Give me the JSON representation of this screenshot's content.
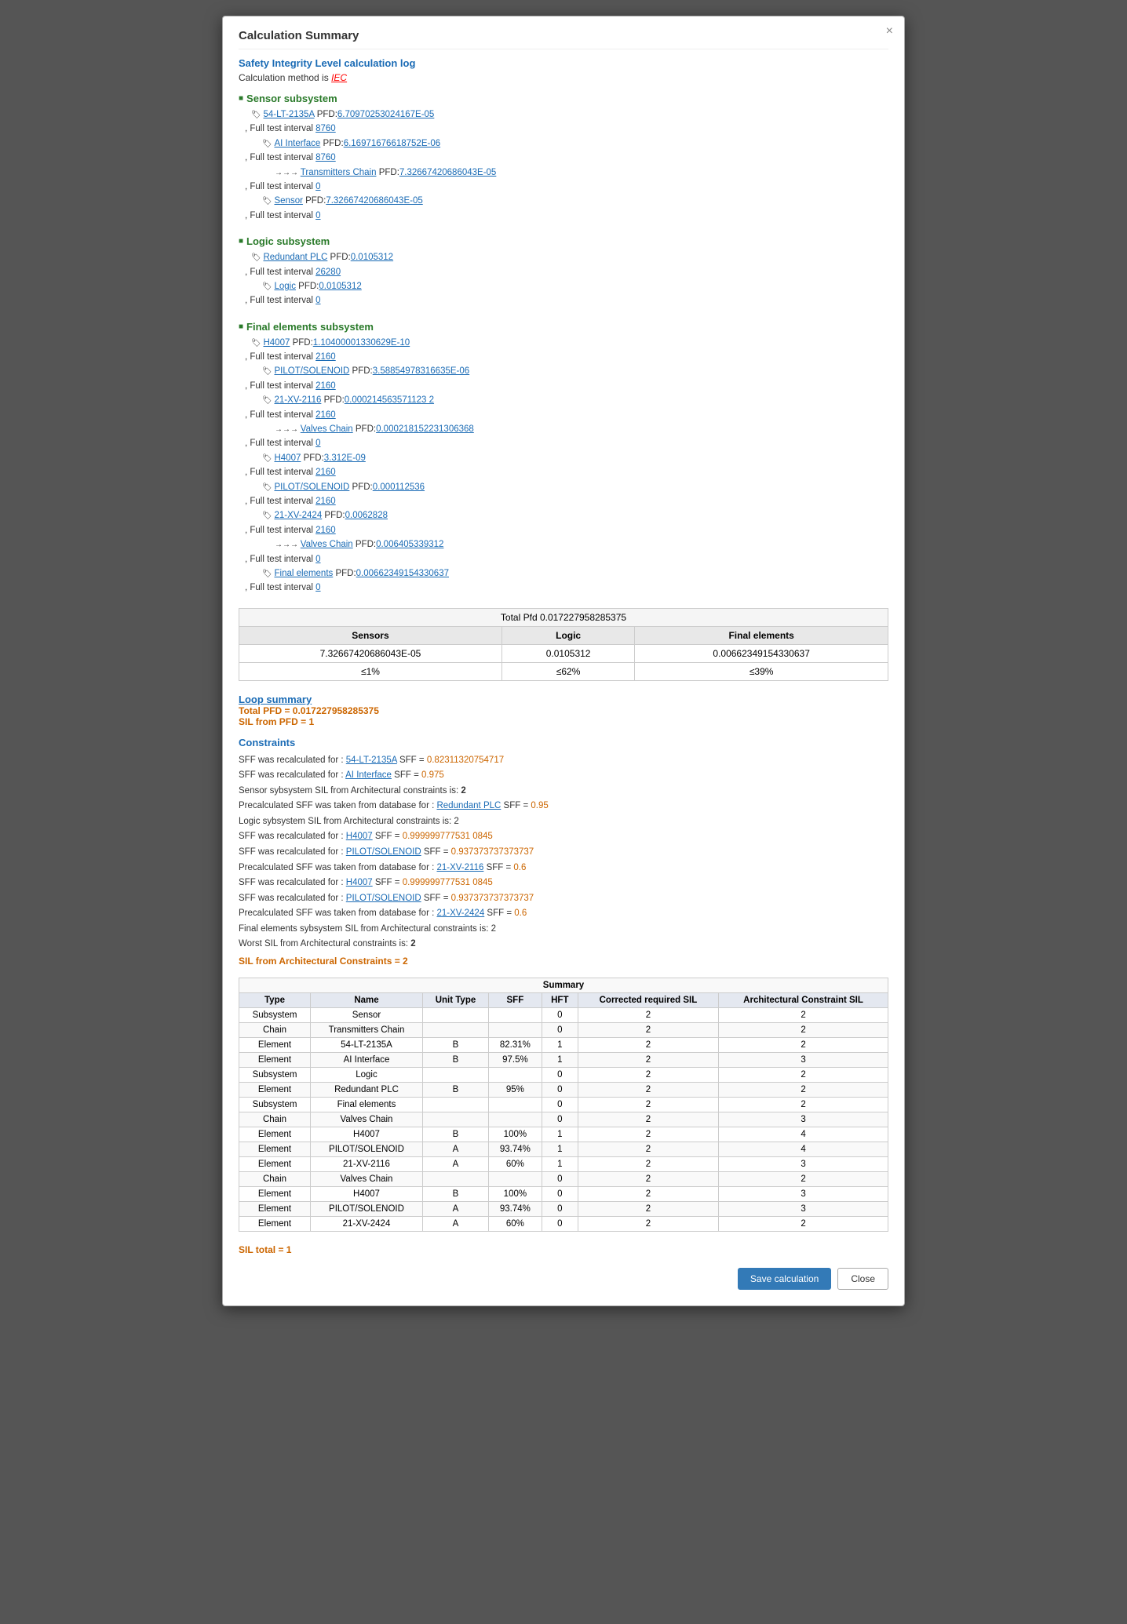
{
  "modal": {
    "title": "Calculation Summary",
    "close_label": "×"
  },
  "header": {
    "sil_title": "Safety Integrity Level calculation log",
    "calc_method_label": "Calculation method is",
    "calc_method_value": "IEC"
  },
  "sensor_subsystem": {
    "title": "Sensor subsystem",
    "lines": [
      {
        "indent": 1,
        "type": "tag",
        "tag": "54-LT-2135A",
        "text": " PFD:",
        "value": "6.70970253024167E-05"
      },
      {
        "indent": 0,
        "text": ", Full test interval ",
        "value": "8760"
      },
      {
        "indent": 2,
        "type": "tag",
        "tag": "AI Interface",
        "text": " PFD:",
        "value": "6.16971676618752E-06"
      },
      {
        "indent": 0,
        "text": ", Full test interval ",
        "value": "8760"
      },
      {
        "indent": 3,
        "type": "arrow",
        "tag": "Transmitters Chain",
        "text": " PFD:",
        "value": "7.32667420686043E-05"
      },
      {
        "indent": 0,
        "text": ", Full test interval ",
        "value": "0"
      },
      {
        "indent": 2,
        "type": "tag",
        "tag": "Sensor",
        "text": " PFD:",
        "value": "7.32667420686043E-05"
      },
      {
        "indent": 0,
        "text": ", Full test interval ",
        "value": "0"
      }
    ]
  },
  "logic_subsystem": {
    "title": "Logic subsystem",
    "lines": [
      {
        "indent": 1,
        "type": "tag",
        "tag": "Redundant PLC",
        "text": " PFD:",
        "value": "0.0105312"
      },
      {
        "indent": 0,
        "text": ", Full test interval ",
        "value": "26280"
      },
      {
        "indent": 2,
        "type": "tag",
        "tag": "Logic",
        "text": " PFD:",
        "value": "0.0105312"
      },
      {
        "indent": 0,
        "text": ", Full test interval ",
        "value": "0"
      }
    ]
  },
  "final_elements_subsystem": {
    "title": "Final elements subsystem",
    "lines": [
      {
        "indent": 1,
        "type": "tag",
        "tag": "H4007",
        "text": " PFD:",
        "value": "1.10400001330629E-10"
      },
      {
        "indent": 0,
        "text": ", Full test interval ",
        "value": "2160"
      },
      {
        "indent": 2,
        "type": "tag",
        "tag": "PILOT/SOLENOID",
        "text": " PFD:",
        "value": "3.58854978316635E-06"
      },
      {
        "indent": 0,
        "text": ", Full test interval ",
        "value": "2160"
      },
      {
        "indent": 2,
        "type": "tag",
        "tag": "21-XV-2116",
        "text": " PFD:",
        "value": "0.000214563571123 2"
      },
      {
        "indent": 0,
        "text": ", Full test interval ",
        "value": "2160"
      },
      {
        "indent": 3,
        "type": "arrow",
        "tag": "Valves Chain",
        "text": " PFD:",
        "value": "0.000218152231306368"
      },
      {
        "indent": 0,
        "text": ", Full test interval ",
        "value": "0"
      },
      {
        "indent": 2,
        "type": "tag",
        "tag": "H4007",
        "text": " PFD:",
        "value": "3.312E-09"
      },
      {
        "indent": 0,
        "text": ", Full test interval ",
        "value": "2160"
      },
      {
        "indent": 2,
        "type": "tag",
        "tag": "PILOT/SOLENOID",
        "text": " PFD:",
        "value": "0.000112536"
      },
      {
        "indent": 0,
        "text": ", Full test interval ",
        "value": "2160"
      },
      {
        "indent": 2,
        "type": "tag",
        "tag": "21-XV-2424",
        "text": " PFD:",
        "value": "0.0062828"
      },
      {
        "indent": 0,
        "text": ", Full test interval ",
        "value": "2160"
      },
      {
        "indent": 3,
        "type": "arrow",
        "tag": "Valves Chain",
        "text": " PFD:",
        "value": "0.006405339312"
      },
      {
        "indent": 0,
        "text": ", Full test interval ",
        "value": "0"
      },
      {
        "indent": 2,
        "type": "tag",
        "tag": "Final elements",
        "text": " PFD:",
        "value": "0.00662349154330637"
      },
      {
        "indent": 0,
        "text": ", Full test interval ",
        "value": "0"
      }
    ]
  },
  "pfd_table": {
    "total_pfd": "Total Pfd 0.017227958285375",
    "headers": [
      "Sensors",
      "Logic",
      "Final elements"
    ],
    "values": [
      "7.32667420686043E-05",
      "0.0105312",
      "0.00662349154330637"
    ],
    "percentages": [
      "≤1%",
      "≤62%",
      "≤39%"
    ]
  },
  "loop_summary": {
    "title": "Loop summary",
    "total_pfd": "Total PFD = 0.017227958285375",
    "sil_from_pfd": "SIL from PFD = 1"
  },
  "constraints": {
    "title": "Constraints",
    "lines": [
      "SFF was recalculated for : 54-LT-2135A  SFF = 0.82311320754717",
      "SFF was recalculated for : AI Interface  SFF = 0.975",
      "Sensor sybsystem SIL from Architectural constraints is:  2",
      "Precalculated SFF was taken from database for :  Redundant PLC  SFF = 0.95",
      "Logic sybsystem SIL from Architectural constraints is: 2",
      "SFF was recalculated for : H4007  SFF = 0.99999977753 10845",
      "SFF was recalculated for : PILOT/SOLENOID  SFF = 0.937373737373737",
      "Precalculated SFF was taken from database for :  21-XV-2116  SFF = 0.6",
      "SFF was recalculated for : H4007  SFF = 0.999999777531 0845",
      "SFF was recalculated for : PILOT/SOLENOID  SFF = 0.937373737373737",
      "Precalculated SFF was taken from database for :  21-XV-2424  SFF = 0.6",
      "Final elements sybsystem SIL from Architectural constraints is: 2",
      "Worst SIL from Architectural constraints is:  2",
      "SIL from Architectural Constraints = 2"
    ],
    "links": {
      "54-LT-2135A": "54-LT-2135A",
      "AI Interface": "AI Interface",
      "Redundant PLC": "Redundant PLC",
      "H4007_1": "H4007",
      "PILOT/SOLENOID_1": "PILOT/SOLENOID",
      "21-XV-2116": "21-XV-2116",
      "H4007_2": "H4007",
      "PILOT/SOLENOID_2": "PILOT/SOLENOID",
      "21-XV-2424": "21-XV-2424"
    }
  },
  "summary_table": {
    "title": "Summary",
    "headers": [
      "Type",
      "Name",
      "Unit Type",
      "SFF",
      "HFT",
      "Corrected required SIL",
      "Architectural Constraint SIL"
    ],
    "rows": [
      [
        "Subsystem",
        "Sensor",
        "",
        "",
        "0",
        "2",
        "2"
      ],
      [
        "Chain",
        "Transmitters Chain",
        "",
        "",
        "0",
        "2",
        "2"
      ],
      [
        "Element",
        "54-LT-2135A",
        "B",
        "82.31%",
        "1",
        "2",
        "2"
      ],
      [
        "Element",
        "AI Interface",
        "B",
        "97.5%",
        "1",
        "2",
        "3"
      ],
      [
        "Subsystem",
        "Logic",
        "",
        "",
        "0",
        "2",
        "2"
      ],
      [
        "Element",
        "Redundant PLC",
        "B",
        "95%",
        "0",
        "2",
        "2"
      ],
      [
        "Subsystem",
        "Final elements",
        "",
        "",
        "0",
        "2",
        "2"
      ],
      [
        "Chain",
        "Valves Chain",
        "",
        "",
        "0",
        "2",
        "3"
      ],
      [
        "Element",
        "H4007",
        "B",
        "100%",
        "1",
        "2",
        "4"
      ],
      [
        "Element",
        "PILOT/SOLENOID",
        "A",
        "93.74%",
        "1",
        "2",
        "4"
      ],
      [
        "Element",
        "21-XV-2116",
        "A",
        "60%",
        "1",
        "2",
        "3"
      ],
      [
        "Chain",
        "Valves Chain",
        "",
        "",
        "0",
        "2",
        "2"
      ],
      [
        "Element",
        "H4007",
        "B",
        "100%",
        "0",
        "2",
        "3"
      ],
      [
        "Element",
        "PILOT/SOLENOID",
        "A",
        "93.74%",
        "0",
        "2",
        "3"
      ],
      [
        "Element",
        "21-XV-2424",
        "A",
        "60%",
        "0",
        "2",
        "2"
      ]
    ]
  },
  "sil_total": "SIL total = 1",
  "buttons": {
    "save": "Save calculation",
    "close": "Close"
  }
}
